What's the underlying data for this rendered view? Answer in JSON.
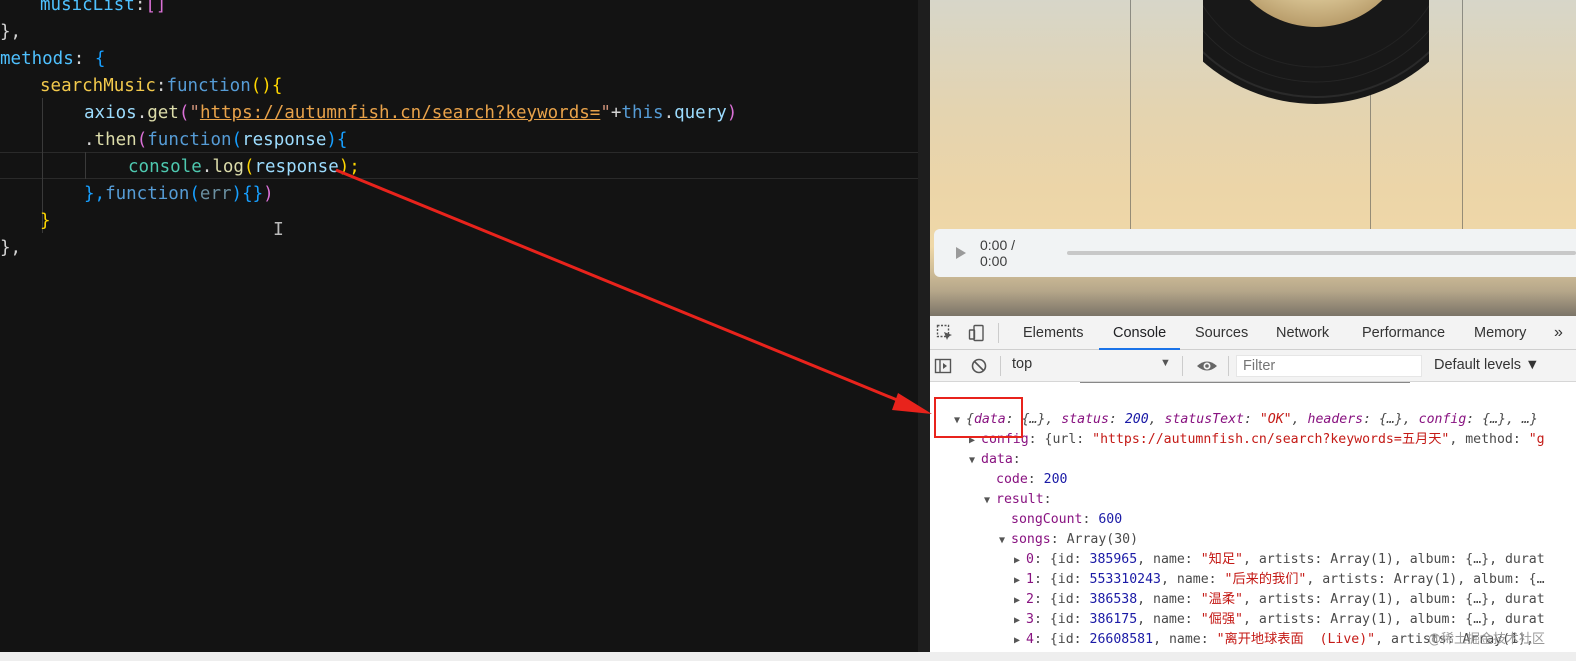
{
  "editor": {
    "lines": [
      {
        "tokens": [
          {
            "t": "musicList",
            "c": "tok-prop"
          },
          {
            "t": ":",
            "c": "tok-punc"
          },
          {
            "t": "[]",
            "c": "tok-brk2"
          }
        ]
      },
      {
        "tokens": [
          {
            "t": "},",
            "c": "tok-punc"
          }
        ]
      },
      {
        "tokens": [
          {
            "t": "methods",
            "c": "tok-prop"
          },
          {
            "t": ": ",
            "c": "tok-punc"
          },
          {
            "t": "{",
            "c": "tok-brk3"
          }
        ]
      },
      {
        "tokens": [
          {
            "t": "searchMusic",
            "c": "tok-func2"
          },
          {
            "t": ":",
            "c": "tok-punc"
          },
          {
            "t": "function",
            "c": "tok-keyword"
          },
          {
            "t": "(){",
            "c": "tok-brk"
          }
        ]
      },
      {
        "tokens": [
          {
            "t": "axios",
            "c": "tok-var"
          },
          {
            "t": ".",
            "c": "tok-punc"
          },
          {
            "t": "get",
            "c": "tok-func"
          },
          {
            "t": "(",
            "c": "tok-brk2"
          },
          {
            "t": "\"",
            "c": "tok-str"
          },
          {
            "t": "https://autumnfish.cn/search?keywords=",
            "c": "tok-url"
          },
          {
            "t": "\"",
            "c": "tok-str"
          },
          {
            "t": "+",
            "c": "tok-punc"
          },
          {
            "t": "this",
            "c": "tok-keyword"
          },
          {
            "t": ".",
            "c": "tok-punc"
          },
          {
            "t": "query",
            "c": "tok-var"
          },
          {
            "t": ")",
            "c": "tok-brk2"
          }
        ]
      },
      {
        "tokens": [
          {
            "t": ".",
            "c": "tok-punc"
          },
          {
            "t": "then",
            "c": "tok-func"
          },
          {
            "t": "(",
            "c": "tok-brk2"
          },
          {
            "t": "function",
            "c": "tok-keyword"
          },
          {
            "t": "(",
            "c": "tok-brk3"
          },
          {
            "t": "response",
            "c": "tok-var"
          },
          {
            "t": "){",
            "c": "tok-brk3"
          }
        ]
      },
      {
        "tokens": [
          {
            "t": "console",
            "c": "tok-cons"
          },
          {
            "t": ".",
            "c": "tok-punc"
          },
          {
            "t": "log",
            "c": "tok-func"
          },
          {
            "t": "(",
            "c": "tok-brk"
          },
          {
            "t": "response",
            "c": "tok-var"
          },
          {
            "t": ");",
            "c": "tok-brk"
          }
        ]
      },
      {
        "tokens": [
          {
            "t": "},",
            "c": "tok-brk3"
          },
          {
            "t": "function",
            "c": "tok-keyword"
          },
          {
            "t": "(",
            "c": "tok-brk3"
          },
          {
            "t": "err",
            "c": "tok-dim"
          },
          {
            "t": "){}",
            "c": "tok-brk3"
          },
          {
            "t": ")",
            "c": "tok-brk2"
          }
        ]
      },
      {
        "tokens": [
          {
            "t": "}",
            "c": "tok-brk"
          }
        ]
      },
      {
        "tokens": [
          {
            "t": "},",
            "c": "tok-punc"
          }
        ]
      }
    ]
  },
  "player": {
    "time": "0:00 / 0:00",
    "progress_fraction": 0
  },
  "devtools": {
    "tabs": [
      "Elements",
      "Console",
      "Sources",
      "Network",
      "Performance",
      "Memory"
    ],
    "active_tab": "Console",
    "more_tabs": "»",
    "context": "top",
    "context_arrow": "▼",
    "filter_placeholder": "Filter",
    "levels": "Default levels ▼"
  },
  "console": {
    "lines": [
      {
        "indent": 0,
        "arrow": "▼",
        "italic": true,
        "parts": [
          {
            "t": "{",
            "c": "kd"
          },
          {
            "t": "data",
            "c": "k"
          },
          {
            "t": ": {…}, ",
            "c": "kd"
          },
          {
            "t": "status",
            "c": "k"
          },
          {
            "t": ": ",
            "c": "kd"
          },
          {
            "t": "200",
            "c": "n"
          },
          {
            "t": ", ",
            "c": "kd"
          },
          {
            "t": "statusText",
            "c": "k"
          },
          {
            "t": ": ",
            "c": "kd"
          },
          {
            "t": "\"OK\"",
            "c": "s"
          },
          {
            "t": ", ",
            "c": "kd"
          },
          {
            "t": "headers",
            "c": "k"
          },
          {
            "t": ": {…}, ",
            "c": "kd"
          },
          {
            "t": "config",
            "c": "k"
          },
          {
            "t": ": {…}, …}",
            "c": "kd"
          }
        ]
      },
      {
        "indent": 1,
        "arrow": "▶",
        "parts": [
          {
            "t": "config",
            "c": "k"
          },
          {
            "t": ": {url: ",
            "c": "kd"
          },
          {
            "t": "\"https://autumnfish.cn/search?keywords=五月天\"",
            "c": "s"
          },
          {
            "t": ", method: ",
            "c": "kd"
          },
          {
            "t": "\"g",
            "c": "s"
          }
        ]
      },
      {
        "indent": 1,
        "arrow": "▼",
        "parts": [
          {
            "t": "data",
            "c": "k"
          },
          {
            "t": ":",
            "c": "kd"
          }
        ]
      },
      {
        "indent": 2,
        "arrow": "",
        "parts": [
          {
            "t": "code",
            "c": "k"
          },
          {
            "t": ": ",
            "c": "kd"
          },
          {
            "t": "200",
            "c": "n"
          }
        ]
      },
      {
        "indent": 2,
        "arrow": "▼",
        "parts": [
          {
            "t": "result",
            "c": "k"
          },
          {
            "t": ":",
            "c": "kd"
          }
        ]
      },
      {
        "indent": 3,
        "arrow": "",
        "parts": [
          {
            "t": "songCount",
            "c": "k"
          },
          {
            "t": ": ",
            "c": "kd"
          },
          {
            "t": "600",
            "c": "n"
          }
        ]
      },
      {
        "indent": 3,
        "arrow": "▼",
        "parts": [
          {
            "t": "songs",
            "c": "k"
          },
          {
            "t": ": Array(30)",
            "c": "kd"
          }
        ]
      },
      {
        "indent": 4,
        "arrow": "▶",
        "parts": [
          {
            "t": "0",
            "c": "k"
          },
          {
            "t": ": {id: ",
            "c": "kd"
          },
          {
            "t": "385965",
            "c": "n"
          },
          {
            "t": ", name: ",
            "c": "kd"
          },
          {
            "t": "\"知足\"",
            "c": "s"
          },
          {
            "t": ", artists: Array(1), album: {…}, durat",
            "c": "kd"
          }
        ]
      },
      {
        "indent": 4,
        "arrow": "▶",
        "parts": [
          {
            "t": "1",
            "c": "k"
          },
          {
            "t": ": {id: ",
            "c": "kd"
          },
          {
            "t": "553310243",
            "c": "n"
          },
          {
            "t": ", name: ",
            "c": "kd"
          },
          {
            "t": "\"后来的我们\"",
            "c": "s"
          },
          {
            "t": ", artists: Array(1), album: {…",
            "c": "kd"
          }
        ]
      },
      {
        "indent": 4,
        "arrow": "▶",
        "parts": [
          {
            "t": "2",
            "c": "k"
          },
          {
            "t": ": {id: ",
            "c": "kd"
          },
          {
            "t": "386538",
            "c": "n"
          },
          {
            "t": ", name: ",
            "c": "kd"
          },
          {
            "t": "\"温柔\"",
            "c": "s"
          },
          {
            "t": ", artists: Array(1), album: {…}, durat",
            "c": "kd"
          }
        ]
      },
      {
        "indent": 4,
        "arrow": "▶",
        "parts": [
          {
            "t": "3",
            "c": "k"
          },
          {
            "t": ": {id: ",
            "c": "kd"
          },
          {
            "t": "386175",
            "c": "n"
          },
          {
            "t": ", name: ",
            "c": "kd"
          },
          {
            "t": "\"倔强\"",
            "c": "s"
          },
          {
            "t": ", artists: Array(1), album: {…}, durat",
            "c": "kd"
          }
        ]
      },
      {
        "indent": 4,
        "arrow": "▶",
        "parts": [
          {
            "t": "4",
            "c": "k"
          },
          {
            "t": ": {id: ",
            "c": "kd"
          },
          {
            "t": "26608581",
            "c": "n"
          },
          {
            "t": ", name: ",
            "c": "kd"
          },
          {
            "t": "\"离开地球表面  (Live)\"",
            "c": "s"
          },
          {
            "t": ", artists: Array(1),",
            "c": "kd"
          }
        ]
      }
    ]
  },
  "watermark": "@稀土掘金技术社区",
  "colors": {
    "annotation": "#e8231c",
    "active_tab_underline": "#1a73e8"
  }
}
